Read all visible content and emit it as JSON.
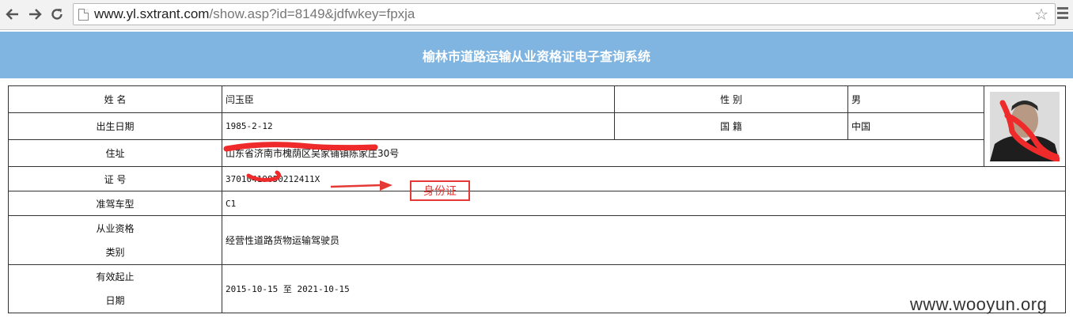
{
  "browser": {
    "url_host": "www.yl.sxtrant.com",
    "url_path": "/show.asp?id=8149&jdfwkey=fpxja",
    "icons": {
      "back": "back-arrow-icon",
      "forward": "forward-arrow-icon",
      "reload": "reload-icon",
      "star": "bookmark-star-icon",
      "menu": "menu-icon"
    }
  },
  "header": {
    "title": "榆林市道路运输从业资格证电子查询系统",
    "bg_color": "#7fb5e0"
  },
  "record": {
    "name_label": "姓 名",
    "name_value": "闫玉臣",
    "gender_label": "性 别",
    "gender_value": "男",
    "birth_label": "出生日期",
    "birth_value": "1985-2-12",
    "nationality_label": "国 籍",
    "nationality_value": "中国",
    "address_label": "住址",
    "address_value": "山东省济南市槐荫区吴家铺镇陈家庄30号",
    "id_label": "证 号",
    "id_value": "37010419850212411X",
    "license_type_label": "准驾车型",
    "license_type_value": "C1",
    "qualification_label_1": "从业资格",
    "qualification_label_2": "类别",
    "qualification_value": "经营性道路货物运输驾驶员",
    "validity_label_1": "有效起止",
    "validity_label_2": "日期",
    "validity_value": "2015-10-15 至 2021-10-15"
  },
  "annotation": {
    "id_card_label": "身份证",
    "color": "#e53935"
  },
  "watermark": "www.wooyun.org"
}
